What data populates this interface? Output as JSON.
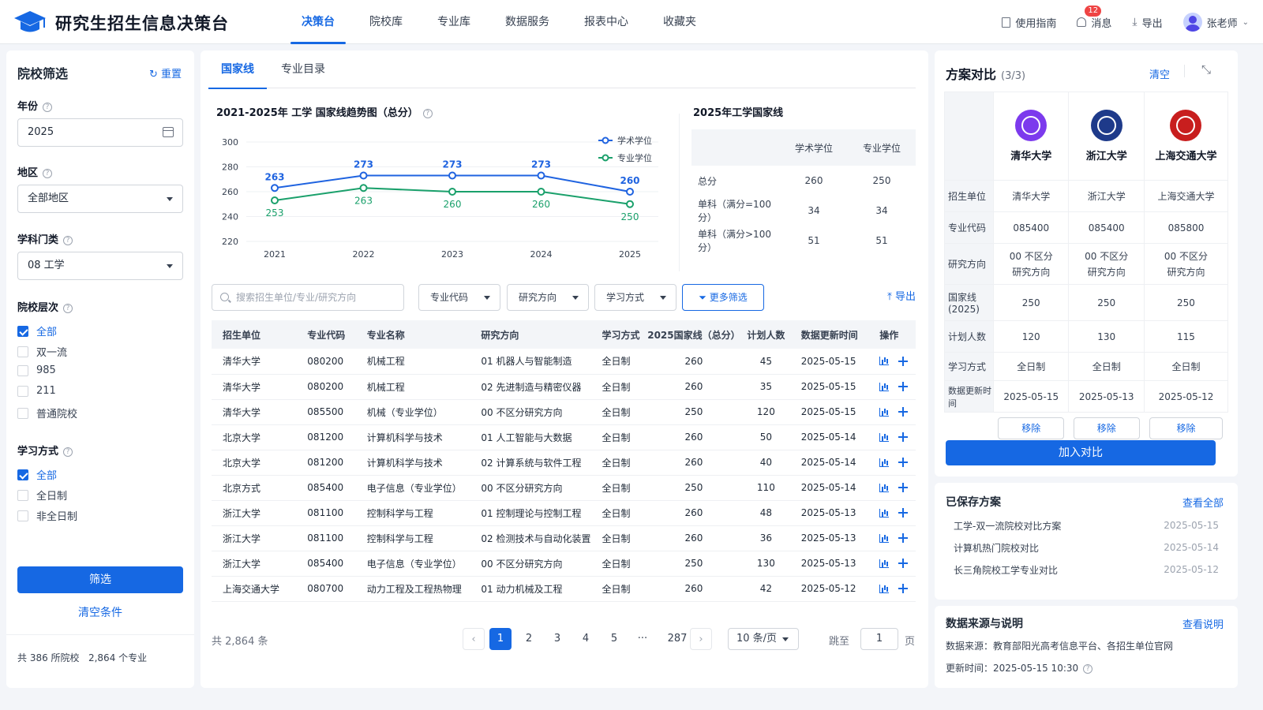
{
  "app": {
    "title": "研究生招生信息决策台"
  },
  "nav": [
    {
      "label": "决策台",
      "active": true
    },
    {
      "label": "院校库"
    },
    {
      "label": "专业库"
    },
    {
      "label": "数据服务"
    },
    {
      "label": "报表中心"
    },
    {
      "label": "收藏夹"
    }
  ],
  "topright": {
    "guide": "使用指南",
    "messages": "消息",
    "message_count": "12",
    "export": "导出",
    "user": "张老师"
  },
  "filter": {
    "title": "院校筛选",
    "reset": "重置",
    "year_label": "年份",
    "year_value": "2025",
    "region_label": "地区",
    "region_value": "全部地区",
    "discipline_label": "学科门类",
    "discipline_value": "08 工学",
    "level_label": "院校层次",
    "levels": [
      {
        "label": "全部",
        "checked": true
      },
      {
        "label": "双一流",
        "checked": false
      },
      {
        "label": "985",
        "checked": false
      },
      {
        "label": "211",
        "checked": false
      },
      {
        "label": "普通院校",
        "checked": false
      }
    ],
    "mode_label": "学习方式",
    "modes": [
      {
        "label": "全部",
        "checked": true
      },
      {
        "label": "全日制",
        "checked": false
      },
      {
        "label": "非全日制",
        "checked": false
      }
    ],
    "apply": "筛选",
    "clear": "清空条件",
    "summary": "共 386 所院校   2,864 个专业"
  },
  "center_tabs": [
    {
      "label": "国家线",
      "active": true
    },
    {
      "label": "专业目录"
    }
  ],
  "trend": {
    "title": "2021-2025年 工学 国家线趋势图（总分）"
  },
  "chart_data": {
    "type": "line",
    "title": "2021-2025年 工学 国家线趋势图（总分）",
    "x": [
      "2021",
      "2022",
      "2023",
      "2024",
      "2025"
    ],
    "ylim": [
      220,
      300
    ],
    "yticks": [
      220,
      240,
      260,
      280,
      300
    ],
    "grid": true,
    "legend": "top-right",
    "series": [
      {
        "name": "学术学位",
        "values": [
          263,
          273,
          273,
          273,
          260
        ],
        "color": "#1f63e0"
      },
      {
        "name": "专业学位",
        "values": [
          253,
          263,
          260,
          260,
          250
        ],
        "color": "#1aa06b"
      }
    ]
  },
  "national_line": {
    "title": "2025年工学国家线",
    "headers": [
      "",
      "学术学位",
      "专业学位"
    ],
    "rows": [
      [
        "总分",
        "260",
        "250"
      ],
      [
        "单科（满分=100分）",
        "34",
        "34"
      ],
      [
        "单科（满分>100分）",
        "51",
        "51"
      ]
    ]
  },
  "toolbar": {
    "search_placeholder": "搜索招生单位/专业/研究方向",
    "code_filter": "专业代码",
    "direction_filter": "研究方向",
    "mode_filter": "学习方式",
    "more": "更多筛选",
    "export": "导出"
  },
  "table": {
    "headers": [
      "招生单位",
      "专业代码",
      "专业名称",
      "研究方向",
      "学习方式",
      "2025国家线（总分）",
      "计划人数",
      "数据更新时间",
      "操作"
    ],
    "rows": [
      [
        "清华大学",
        "080200",
        "机械工程",
        "01 机器人与智能制造",
        "全日制",
        "260",
        "45",
        "2025-05-15"
      ],
      [
        "清华大学",
        "080200",
        "机械工程",
        "02 先进制造与精密仪器",
        "全日制",
        "260",
        "35",
        "2025-05-15"
      ],
      [
        "清华大学",
        "085500",
        "机械（专业学位）",
        "00 不区分研究方向",
        "全日制",
        "250",
        "120",
        "2025-05-15"
      ],
      [
        "北京大学",
        "081200",
        "计算机科学与技术",
        "01 人工智能与大数据",
        "全日制",
        "260",
        "50",
        "2025-05-14"
      ],
      [
        "北京大学",
        "081200",
        "计算机科学与技术",
        "02 计算系统与软件工程",
        "全日制",
        "260",
        "40",
        "2025-05-14"
      ],
      [
        "北京方式",
        "085400",
        "电子信息（专业学位）",
        "00 不区分研究方向",
        "全日制",
        "250",
        "110",
        "2025-05-14"
      ],
      [
        "浙江大学",
        "081100",
        "控制科学与工程",
        "01 控制理论与控制工程",
        "全日制",
        "260",
        "48",
        "2025-05-13"
      ],
      [
        "浙江大学",
        "081100",
        "控制科学与工程",
        "02 检测技术与自动化装置",
        "全日制",
        "260",
        "36",
        "2025-05-13"
      ],
      [
        "浙江大学",
        "085400",
        "电子信息（专业学位）",
        "00 不区分研究方向",
        "全日制",
        "250",
        "130",
        "2025-05-13"
      ],
      [
        "上海交通大学",
        "080700",
        "动力工程及工程热物理",
        "01 动力机械及工程",
        "全日制",
        "260",
        "42",
        "2025-05-12"
      ]
    ]
  },
  "pager": {
    "total": "共 2,864 条",
    "pages": [
      "1",
      "2",
      "3",
      "4",
      "5",
      "···",
      "287"
    ],
    "per_page": "10 条/页",
    "jump_label": "跳至",
    "jump_value": "1",
    "page_suffix": "页"
  },
  "compare": {
    "title": "方案对比",
    "count": "(3/3)",
    "clear": "清空",
    "schools": [
      {
        "name": "清华大学",
        "color": "#7c3aed"
      },
      {
        "name": "浙江大学",
        "color": "#1e3a8a"
      },
      {
        "name": "上海交通大学",
        "color": "#c81e1e"
      }
    ],
    "rows": [
      {
        "label": "招生单位",
        "values": [
          "清华大学",
          "浙江大学",
          "上海交通大学"
        ]
      },
      {
        "label": "专业代码",
        "values": [
          "085400",
          "085400",
          "085800"
        ]
      },
      {
        "label": "研究方向",
        "values": [
          "00 不区分\n研究方向",
          "00 不区分\n研究方向",
          "00 不区分\n研究方向"
        ]
      },
      {
        "label": "国家线\n(2025)",
        "values": [
          "250",
          "250",
          "250"
        ]
      },
      {
        "label": "计划人数",
        "values": [
          "120",
          "130",
          "115"
        ]
      },
      {
        "label": "学习方式",
        "values": [
          "全日制",
          "全日制",
          "全日制"
        ]
      },
      {
        "label": "数据更新时间",
        "values": [
          "2025-05-15",
          "2025-05-13",
          "2025-05-12"
        ]
      }
    ],
    "remove": "移除",
    "add": "加入对比"
  },
  "saved": {
    "title": "已保存方案",
    "view_all": "查看全部",
    "items": [
      {
        "name": "工学-双一流院校对比方案",
        "date": "2025-05-15"
      },
      {
        "name": "计算机热门院校对比",
        "date": "2025-05-14"
      },
      {
        "name": "长三角院校工学专业对比",
        "date": "2025-05-12"
      }
    ]
  },
  "source": {
    "title": "数据来源与说明",
    "link": "查看说明",
    "line1": "数据来源：教育部阳光高考信息平台、各招生单位官网",
    "line2": "更新时间：2025-05-15 10:30"
  }
}
